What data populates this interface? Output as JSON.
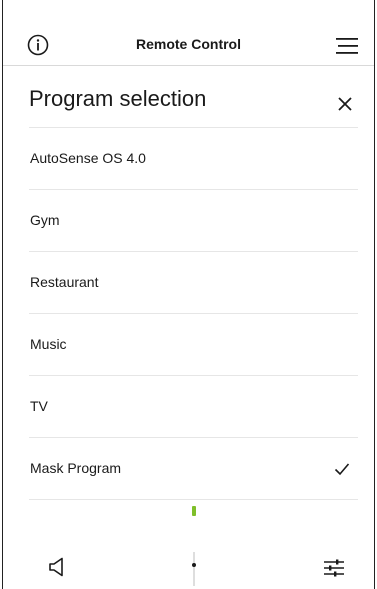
{
  "header": {
    "title": "Remote Control",
    "info_icon": "info-icon",
    "menu_icon": "hamburger-menu-icon"
  },
  "panel": {
    "title": "Program selection",
    "close_icon": "close-icon"
  },
  "programs": [
    {
      "label": "AutoSense OS 4.0",
      "selected": false
    },
    {
      "label": "Gym",
      "selected": false
    },
    {
      "label": "Restaurant",
      "selected": false
    },
    {
      "label": "Music",
      "selected": false
    },
    {
      "label": "TV",
      "selected": false
    },
    {
      "label": "Mask Program",
      "selected": true
    }
  ],
  "bottom_bar": {
    "speaker_icon": "speaker-icon",
    "volume_slider": "volume-slider",
    "settings_icon": "sliders-settings-icon"
  },
  "colors": {
    "accent": "#7fbf2a",
    "text": "#1a1a1a",
    "divider": "#e6e6e6"
  }
}
